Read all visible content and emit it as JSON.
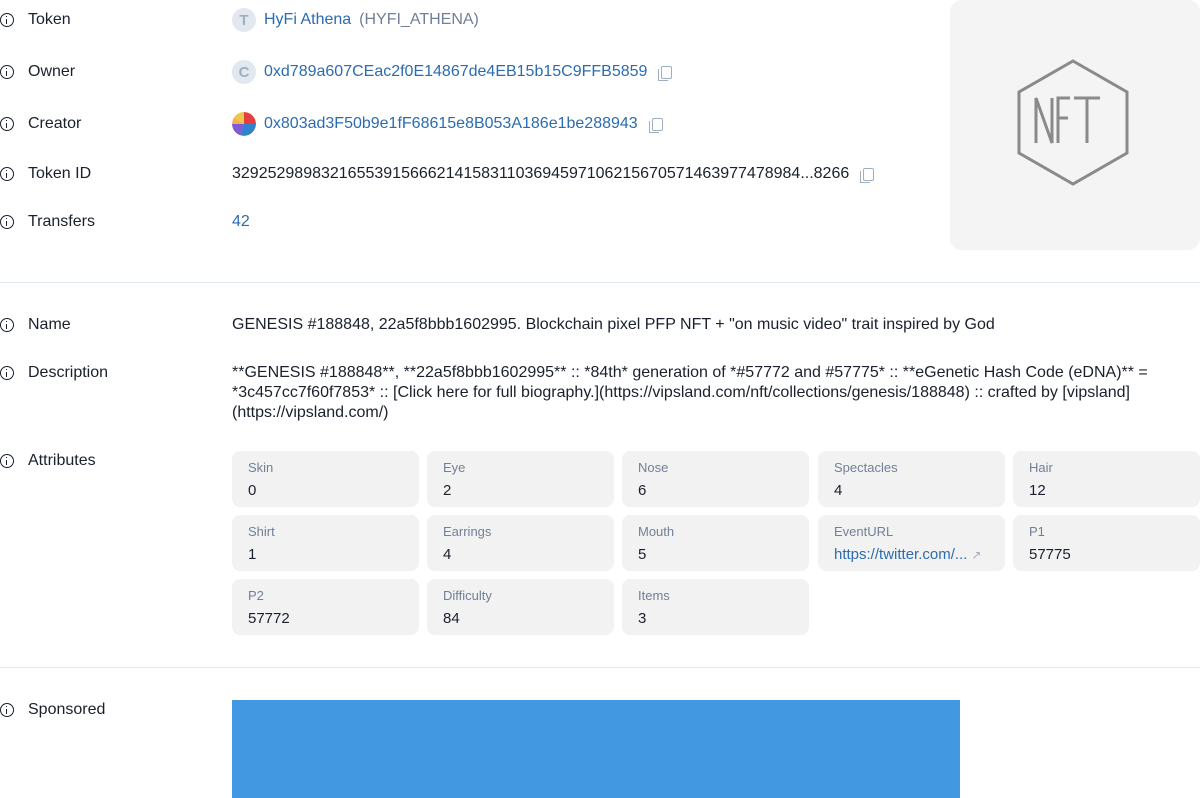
{
  "token": {
    "label": "Token",
    "avatar_letter": "T",
    "name": "HyFi Athena",
    "symbol": "(HYFI_ATHENA)"
  },
  "owner": {
    "label": "Owner",
    "avatar_letter": "C",
    "address": "0xd789a607CEac2f0E14867de4EB15b15C9FFB5859"
  },
  "creator": {
    "label": "Creator",
    "address": "0x803ad3F50b9e1fF68615e8B053A186e1be288943"
  },
  "token_id": {
    "label": "Token ID",
    "value": "32925298983216553915666214158311036945971062156705714639774789​84...8266"
  },
  "transfers": {
    "label": "Transfers",
    "value": "42"
  },
  "name": {
    "label": "Name",
    "value": "GENESIS #188848, 22a5f8bbb1602995. Blockchain pixel PFP NFT + \"on music video\" trait inspired by God"
  },
  "description": {
    "label": "Description",
    "value": "**GENESIS #188848**, **22a5f8bbb1602995** :: *84th* generation of *#57772 and #57775* :: **eGenetic Hash Code (eDNA)** = *3c457cc7f60f7853* :: [Click here for full biography.](https://vipsland.com/nft/collections/genesis/188848) :: crafted by [vipsland](https://vipsland.com/)"
  },
  "attributes": {
    "label": "Attributes",
    "items": [
      {
        "key": "Skin",
        "value": "0"
      },
      {
        "key": "Eye",
        "value": "2"
      },
      {
        "key": "Nose",
        "value": "6"
      },
      {
        "key": "Spectacles",
        "value": "4"
      },
      {
        "key": "Hair",
        "value": "12"
      },
      {
        "key": "Shirt",
        "value": "1"
      },
      {
        "key": "Earrings",
        "value": "4"
      },
      {
        "key": "Mouth",
        "value": "5"
      },
      {
        "key": "EventURL",
        "value": "https://twitter.com/..."
      },
      {
        "key": "P1",
        "value": "57775"
      },
      {
        "key": "P2",
        "value": "57772"
      },
      {
        "key": "Difficulty",
        "value": "84"
      },
      {
        "key": "Items",
        "value": "3"
      }
    ]
  },
  "sponsored": {
    "label": "Sponsored"
  },
  "colors": {
    "link": "#2b6cb0",
    "sponsor_banner": "#4299e1"
  },
  "nft_placeholder": {
    "icon": "nft-hexagon-icon",
    "text": "NFT"
  }
}
